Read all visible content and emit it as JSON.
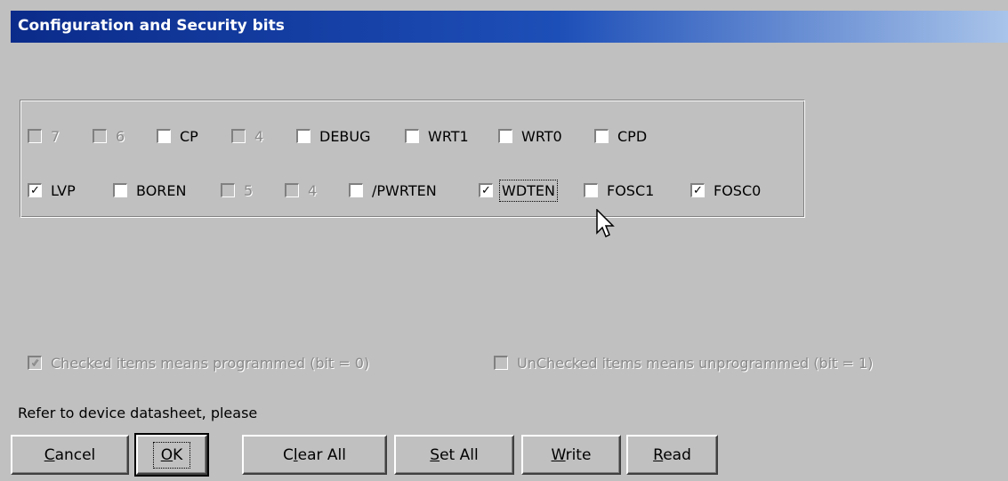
{
  "window": {
    "title": "Configuration and Security bits"
  },
  "config_bits": {
    "row1": [
      {
        "label": "7",
        "checked": false,
        "enabled": false
      },
      {
        "label": "6",
        "checked": false,
        "enabled": false
      },
      {
        "label": "CP",
        "checked": false,
        "enabled": true
      },
      {
        "label": "4",
        "checked": false,
        "enabled": false
      },
      {
        "label": "DEBUG",
        "checked": false,
        "enabled": true
      },
      {
        "label": "WRT1",
        "checked": false,
        "enabled": true
      },
      {
        "label": "WRT0",
        "checked": false,
        "enabled": true
      },
      {
        "label": "CPD",
        "checked": false,
        "enabled": true
      }
    ],
    "row2": [
      {
        "label": "LVP",
        "checked": true,
        "enabled": true
      },
      {
        "label": "BOREN",
        "checked": false,
        "enabled": true
      },
      {
        "label": "5",
        "checked": false,
        "enabled": false
      },
      {
        "label": "4",
        "checked": false,
        "enabled": false
      },
      {
        "label": "/PWRTEN",
        "checked": false,
        "enabled": true
      },
      {
        "label": "WDTEN",
        "checked": true,
        "enabled": true,
        "focused": true
      },
      {
        "label": "FOSC1",
        "checked": false,
        "enabled": true
      },
      {
        "label": "FOSC0",
        "checked": true,
        "enabled": true
      }
    ]
  },
  "legend": {
    "checked_label": "Checked items means programmed (bit = 0)",
    "unchecked_label": "UnChecked items means unprogrammed (bit = 1)"
  },
  "note": "Refer to device datasheet, please",
  "buttons": {
    "cancel": {
      "label": "Cancel",
      "accel": "C"
    },
    "ok": {
      "label": "OK",
      "accel": "O"
    },
    "clear_all": {
      "label": "Clear All",
      "accel": "l"
    },
    "set_all": {
      "label": "Set All",
      "accel": "S"
    },
    "write": {
      "label": "Write",
      "accel": "W"
    },
    "read": {
      "label": "Read",
      "accel": "R"
    }
  },
  "colors": {
    "dialog_bg": "#c0c0c0",
    "titlebar_start": "#0b2b8a",
    "titlebar_end": "#a9c4ea"
  }
}
